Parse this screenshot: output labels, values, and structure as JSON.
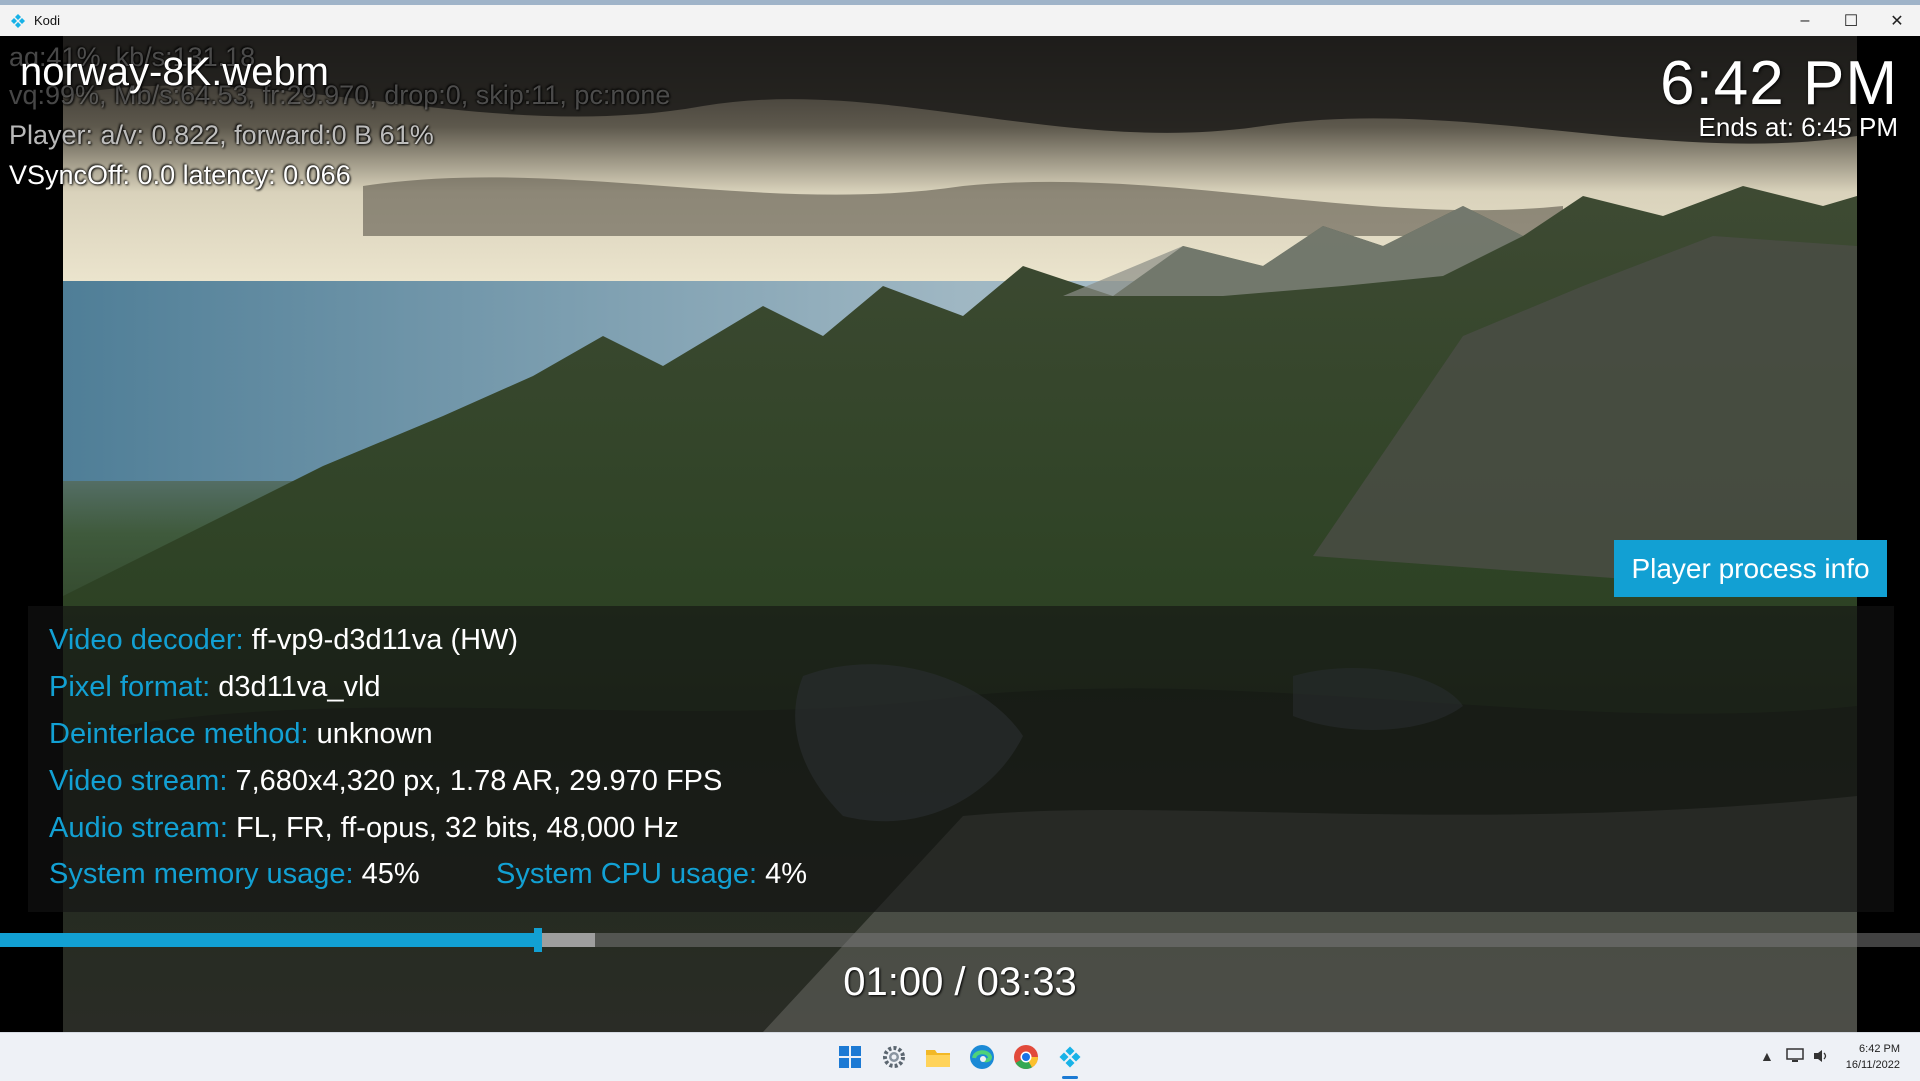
{
  "window": {
    "title": "Kodi",
    "minimize": "–",
    "maximize": "☐",
    "close": "✕"
  },
  "osd": {
    "file_name": "norway-8K.webm",
    "clock": "6:42 PM",
    "ends_at": "Ends at: 6:45 PM"
  },
  "debug": {
    "line1": "aq:41%, kb/s:131.18",
    "line2": "vq:99%, Mb/s:64.53, fr:29.970, drop:0, skip:11, pc:none",
    "line3": "Player: a/v: 0.822,  forward:0 B 61%",
    "line4": "VSyncOff: 0.0 latency: 0.066"
  },
  "panel": {
    "header": "Player process info",
    "rows": [
      {
        "key": "Video decoder:",
        "value": "ff-vp9-d3d11va (HW)"
      },
      {
        "key": "Pixel format:",
        "value": "d3d11va_vld"
      },
      {
        "key": "Deinterlace method:",
        "value": "unknown"
      },
      {
        "key": "Video stream:",
        "value": "7,680x4,320 px, 1.78 AR, 29.970 FPS"
      },
      {
        "key": "Audio stream:",
        "value": "FL, FR, ff-opus, 32 bits, 48,000 Hz"
      }
    ],
    "memory": {
      "key": "System memory usage:",
      "value": "45%"
    },
    "cpu": {
      "key": "System CPU usage:",
      "value": "4%"
    }
  },
  "playback": {
    "time": "01:00 / 03:33",
    "progress": 0.28,
    "cache": 0.31
  },
  "taskbar": {
    "tray_time": "6:42 PM",
    "tray_date": "16/11/2022",
    "accent": "#1c7ad4"
  },
  "colors": {
    "kodi_blue": "#12a0d3"
  }
}
